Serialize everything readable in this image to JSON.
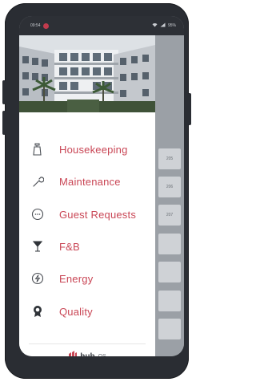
{
  "status_bar": {
    "time": "09:54",
    "battery": "95%"
  },
  "rooms": [
    "205",
    "206",
    "207",
    "",
    "",
    "",
    ""
  ],
  "menu": [
    {
      "label": "Housekeeping",
      "icon": "spray-bottle-icon"
    },
    {
      "label": "Maintenance",
      "icon": "wrench-icon"
    },
    {
      "label": "Guest Requests",
      "icon": "chat-bubble-icon"
    },
    {
      "label": "F&B",
      "icon": "cocktail-glass-icon"
    },
    {
      "label": "Energy",
      "icon": "lightning-bolt-icon"
    },
    {
      "label": "Quality",
      "icon": "award-ribbon-icon"
    }
  ],
  "brand": {
    "name": "hub",
    "suffix": "OS"
  },
  "colors": {
    "accent": "#c94655",
    "frame": "#2a2d33",
    "drawer_bg": "#ffffff",
    "backdrop": "#9ba0a6"
  }
}
